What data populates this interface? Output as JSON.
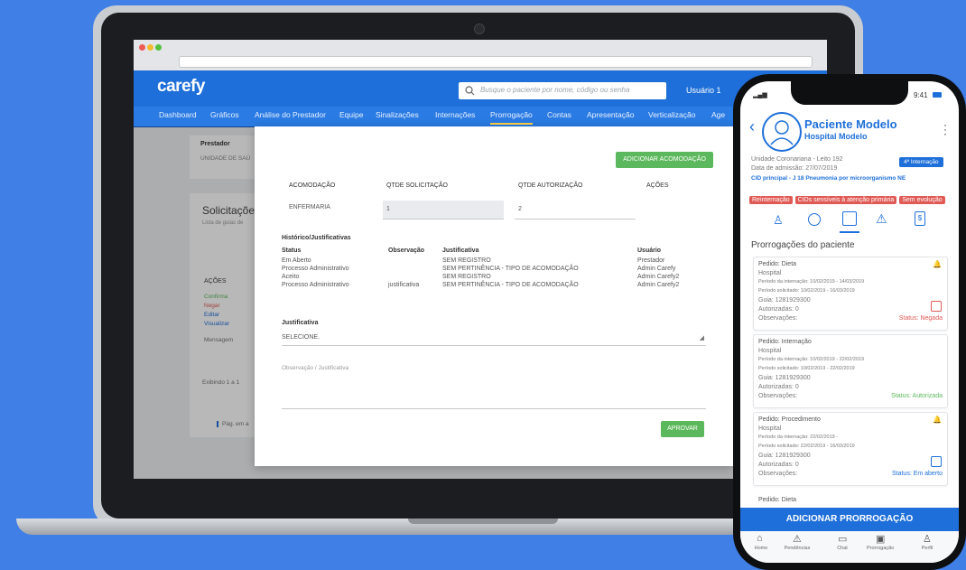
{
  "app": {
    "logo": "carefy",
    "search_placeholder": "Busque o paciente por nome, código ou senha",
    "user": "Usuário 1"
  },
  "nav": [
    "Dashboard",
    "Gráficos",
    "Análise do Prestador",
    "Equipe",
    "Sinalizações",
    "Internações",
    "Prorrogação",
    "Contas",
    "Apresentação",
    "Verticalização",
    "Age"
  ],
  "nav_selected": "Prorrogação",
  "background": {
    "prestador_label": "Prestador",
    "prestador_value": "UNIDADE DE SAÚ",
    "solicitacoes": "Solicitaçõe",
    "solic_sub": "Lista de guias de",
    "acoes": "AÇÕES",
    "actions": [
      "Confirma",
      "Negar",
      "Editar",
      "Visualizar"
    ],
    "mensagem": "Mensagem",
    "exibindo": "Exibindo 1 a 1",
    "pag": "Pág. em a"
  },
  "modal": {
    "add_button": "ADICIONAR ACOMODAÇÃO",
    "cols": [
      "ACOMODAÇÃO",
      "QTDE SOLICITAÇÃO",
      "QTDE AUTORIZAÇÃO",
      "AÇÕES"
    ],
    "row": {
      "acomodacao": "ENFERMARIA",
      "qtde_sol": "1",
      "qtde_aut": "2"
    },
    "historico_title": "Histórico/Justificativas",
    "hist_cols": [
      "Status",
      "Observação",
      "Justificativa",
      "Usuário"
    ],
    "hist_rows": [
      {
        "status": "Em Aberto",
        "obs": "",
        "just": "SEM REGISTRO",
        "user": "Prestador"
      },
      {
        "status": "Processo Administrativo",
        "obs": "",
        "just": "SEM PERTINÊNCIA - TIPO DE ACOMODAÇÃO",
        "user": "Admin Carefy"
      },
      {
        "status": "Aceito",
        "obs": "",
        "just": "SEM REGISTRO",
        "user": "Admin Carefy2"
      },
      {
        "status": "Processo Administrativo",
        "obs": "justificativa",
        "just": "SEM PERTINÊNCIA - TIPO DE ACOMODAÇÃO",
        "user": "Admin Carefy2"
      }
    ],
    "justificativa_label": "Justificativa",
    "select_value": "SELECIONE.",
    "obs_placeholder": "Observação / Justificativa",
    "approve": "APROVAR"
  },
  "phone": {
    "time": "9:41",
    "name": "Paciente Modelo",
    "hospital": "Hospital Modelo",
    "unidade": "Unidade Coronariana - Leito 192",
    "admissao": "Data de admissão: 27/07/2019",
    "internacao_badge": "4ª Internação",
    "cid": "CID principal - J 18 Pneumonia por microorganismo NE",
    "tags": [
      "Reinternação",
      "CIDs sensíveis à atenção primária",
      "Sem evolução"
    ],
    "section_title": "Prorrogações do paciente",
    "cards": [
      {
        "pedido": "Pedido: Dieta",
        "local": "Hospital",
        "periodo_int": "Período da internação: 10/02/2019 - 14/03/2019",
        "periodo_sol": "Período solicitado: 10/02/2019 - 16/03/2019",
        "guia": "Guia: 1281929300",
        "autorizadas": "Autorizadas: 0",
        "obs": "Observações:",
        "status": "Status: Negada",
        "status_color": "#e05a55"
      },
      {
        "pedido": "Pedido: Internação",
        "local": "Hospital",
        "periodo_int": "Período da internação: 10/02/2019 - 22/02/2019",
        "periodo_sol": "Período solicitado: 10/02/2019 - 22/02/2019",
        "guia": "Guia: 1281929300",
        "autorizadas": "Autorizadas: 0",
        "obs": "Observações:",
        "status": "Status: Autorizada",
        "status_color": "#5cb85c"
      },
      {
        "pedido": "Pedido: Procedimento",
        "local": "Hospital",
        "periodo_int": "Período da internação: 22/02/2019 - ",
        "periodo_sol": "Período solicitado: 22/02/2019 - 16/03/2019",
        "guia": "Guia: 1281929300",
        "autorizadas": "Autorizadas: 0",
        "obs": "Observações:",
        "status": "Status: Em aberto",
        "status_color": "#1e6fd9"
      }
    ],
    "last_card": "Pedido: Dieta",
    "add_button": "ADICIONAR PRORROGAÇÃO",
    "bottom_nav": [
      "Home",
      "Pendências",
      "Chat",
      "Prorrogação",
      "Perfil"
    ]
  }
}
